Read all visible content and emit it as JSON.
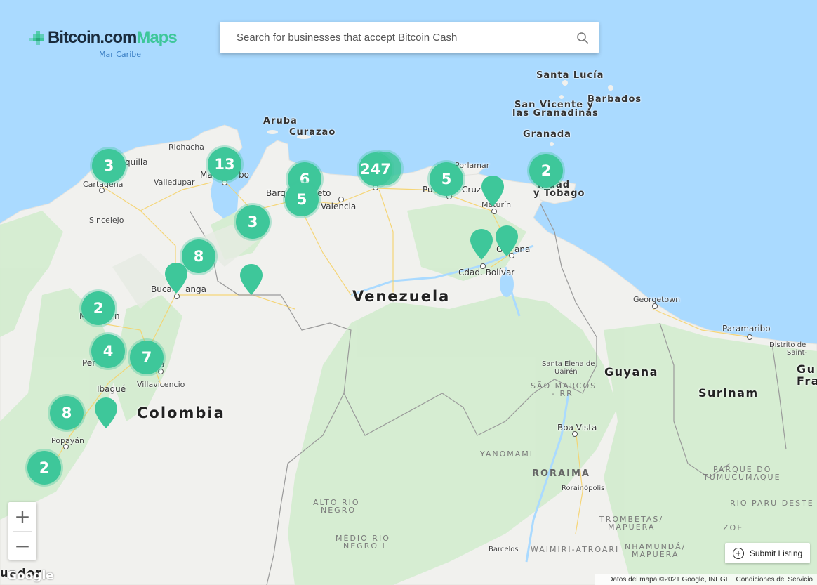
{
  "header": {
    "logo_text": "Bitcoin.com",
    "logo_maps": "Maps",
    "search_placeholder": "Search for businesses that accept Bitcoin Cash"
  },
  "map": {
    "sea_label": "Mar Caribe",
    "countries": {
      "venezuela": "Venezuela",
      "colombia": "Colombia",
      "guyana": "Guyana",
      "surinam": "Surinam",
      "guiana_partial_1": "Gu",
      "guiana_partial_2": "Fra"
    },
    "islands": {
      "aruba": "Aruba",
      "curazao": "Curazao",
      "santa_lucia": "Santa Lucía",
      "barbados": "Barbados",
      "san_vicente": "San Vicente y",
      "granadinas": "las Granadinas",
      "granada": "Granada",
      "trinidad_1": "nidad",
      "trinidad_2": "y Tobago"
    },
    "cities": {
      "riohacha": "Riohacha",
      "quilla": "quilla",
      "cartagena": "Cartagena",
      "valledupar": "Valledupar",
      "maracaibo_a": "Ma",
      "maracaibo_b": "bo",
      "sincelejo": "Sincelejo",
      "barquisimeto_a": "Barq",
      "barquisimeto_b": "eto",
      "valencia": "Valencia",
      "porlamar": "Porlamar",
      "puerto_cruz_a": "Pu",
      "puerto_cruz_b": "Cruz",
      "maturin": "Maturín",
      "guayana": "Gu",
      "guayana_b": "ana",
      "cdad_bolivar": "Cdad. Bolívar",
      "bucaramanga_a": "Bucar",
      "bucaramanga_b": "anga",
      "medellin_a": "M",
      "medellin_b": "n",
      "pereira": "Per",
      "ibague": "Ibagué",
      "bogota": "a",
      "villavicencio": "Villavicencio",
      "popayan": "Popayán",
      "georgetown": "Georgetown",
      "paramaribo": "Paramaribo",
      "distrito": "Distrito de",
      "saint": "Saint-",
      "santa_elena_1": "Santa Elena de",
      "santa_elena_2": "Uairén",
      "boa_vista": "Boa Vista",
      "rorainopolis": "Rorainópolis",
      "barcelos": "Barcelos",
      "ecuador_partial": "uador"
    },
    "regions": {
      "sao_marcos_1": "SÃO MARCOS",
      "sao_marcos_2": "- RR",
      "yanomami": "YANOMAMI",
      "roraima": "RORAIMA",
      "alto_rio_negro_1": "ALTO RIO",
      "alto_rio_negro_2": "NEGRO",
      "medio_rio_negro_1": "MÉDIO RIO",
      "medio_rio_negro_2": "NEGRO I",
      "trombetas_1": "TROMBETAS/",
      "trombetas_2": "MAPUERA",
      "waimiri": "WAIMIRI-ATROARI",
      "nhamunda_1": "NHAMUNDÁ/",
      "nhamunda_2": "MAPUERA",
      "tumucumaque_1": "PARQUE DO",
      "tumucumaque_2": "TUMUCUMAQUE",
      "rio_paru": "RIO PARU DESTE",
      "zoe": "ZOE"
    },
    "clusters": [
      {
        "id": "cartagena",
        "count": "3"
      },
      {
        "id": "maracaibo",
        "count": "13"
      },
      {
        "id": "barquisimeto-north",
        "count": "6"
      },
      {
        "id": "barquisimeto",
        "count": "5"
      },
      {
        "id": "caracas",
        "count": "247"
      },
      {
        "id": "puerto-la-cruz",
        "count": "5"
      },
      {
        "id": "trinidad",
        "count": "2"
      },
      {
        "id": "trujillo",
        "count": "3"
      },
      {
        "id": "cucuta",
        "count": "8"
      },
      {
        "id": "medellin",
        "count": "2"
      },
      {
        "id": "pereira",
        "count": "4"
      },
      {
        "id": "bogota",
        "count": "7"
      },
      {
        "id": "cali",
        "count": "8"
      },
      {
        "id": "pasto",
        "count": "2"
      }
    ]
  },
  "controls": {
    "zoom_in": "+",
    "zoom_out": "−",
    "submit_listing": "Submit Listing"
  },
  "footer": {
    "google": "Google",
    "attribution": "Datos del mapa ©2021 Google, INEGI",
    "terms": "Condiciones del Servicio"
  },
  "colors": {
    "water": "#aadaff",
    "land": "#f2f2f0",
    "forest": "#d4ecd0",
    "accent": "#3ec79a"
  }
}
